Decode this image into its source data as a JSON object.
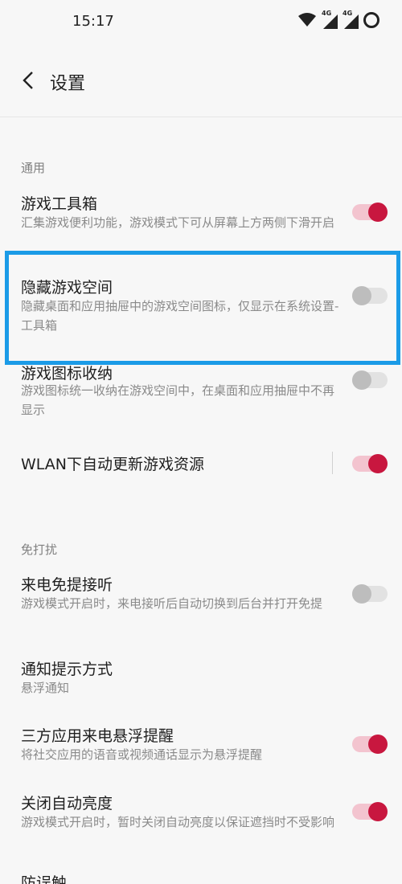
{
  "status_bar": {
    "time": "15:17",
    "signal_label_1": "4G",
    "signal_label_2": "4G"
  },
  "header": {
    "title": "设置"
  },
  "sections": {
    "general": "通用",
    "dnd": "免打扰"
  },
  "items": {
    "toolbox": {
      "title": "游戏工具箱",
      "desc": "汇集游戏便利功能，游戏模式下可从屏幕上方两侧下滑开启",
      "enabled": true
    },
    "hide_space": {
      "title": "隐藏游戏空间",
      "desc": "隐藏桌面和应用抽屉中的游戏空间图标，仅显示在系统设置-工具箱",
      "enabled": false
    },
    "icon_collect": {
      "title": "游戏图标收纳",
      "desc": "游戏图标统一收纳在游戏空间中，在桌面和应用抽屉中不再显示",
      "enabled": false
    },
    "wlan_update": {
      "title": "WLAN下自动更新游戏资源",
      "enabled": true
    },
    "call_handsfree": {
      "title": "来电免提接听",
      "desc": "游戏模式开启时，来电接听后自动切换到后台并打开免提",
      "enabled": false
    },
    "notify_style": {
      "title": "通知提示方式",
      "desc": "悬浮通知"
    },
    "third_party_call": {
      "title": "三方应用来电悬浮提醒",
      "desc": "将社交应用的语音或视频通话显示为悬浮提醒",
      "enabled": true
    },
    "auto_brightness": {
      "title": "关闭自动亮度",
      "desc": "游戏模式开启时，暂时关闭自动亮度以保证遮挡时不受影响",
      "enabled": true
    },
    "anti_touch": {
      "title": "防误触"
    }
  },
  "colors": {
    "accent": "#c8173f",
    "accent_track": "#f3c4cf",
    "highlight": "#1b9be7"
  }
}
